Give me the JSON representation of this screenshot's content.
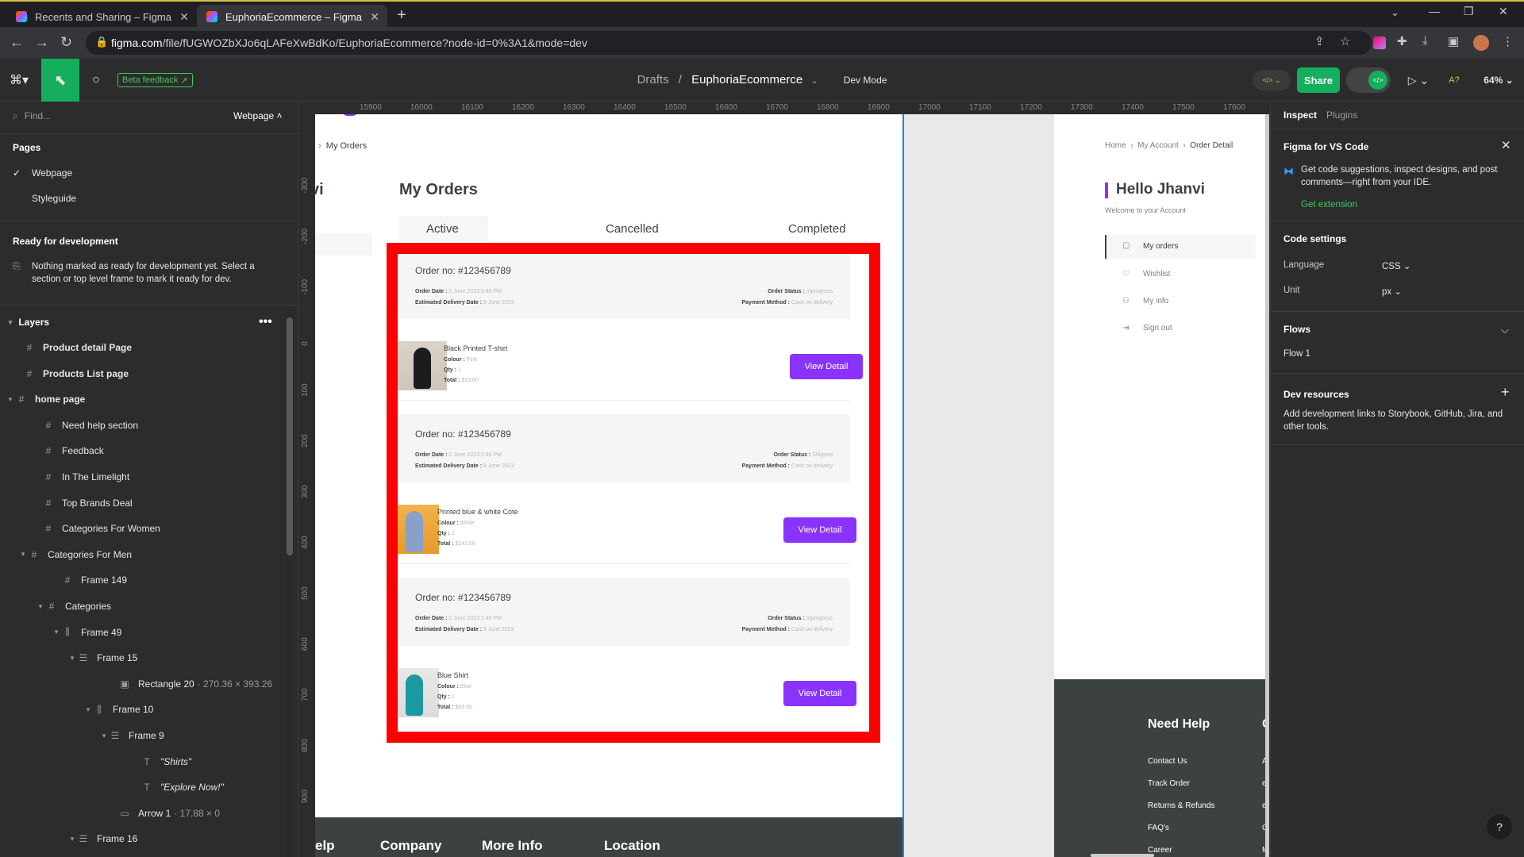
{
  "browser": {
    "tabs": [
      {
        "title": "Recents and Sharing – Figma"
      },
      {
        "title": "EuphoriaEcommerce – Figma"
      }
    ],
    "url_domain": "figma.com",
    "url_path": "/file/fUGWOZbXJo6qLAFeXwBdKo/EuphoriaEcommerce?node-id=0%3A1&mode=dev"
  },
  "toolbar": {
    "beta_feedback": "Beta feedback",
    "crumb_drafts": "Drafts",
    "crumb_sep": "/",
    "file_name": "EuphoriaEcommerce",
    "dev_mode": "Dev Mode",
    "share": "Share",
    "zoom": "64%",
    "dev_toggle": "</>"
  },
  "left_panel": {
    "find_placeholder": "Find...",
    "page_select": "Webpage",
    "pages_title": "Pages",
    "pages": [
      "Webpage",
      "Styleguide"
    ],
    "ready_title": "Ready for development",
    "ready_text": "Nothing marked as ready for development yet. Select a section or top level frame to mark it ready for dev.",
    "layers_title": "Layers",
    "layers": [
      {
        "name": "Product detail Page",
        "dim": ""
      },
      {
        "name": "Products List page",
        "dim": ""
      },
      {
        "name": "home page",
        "dim": ""
      },
      {
        "name": "Need help section",
        "dim": ""
      },
      {
        "name": "Feedback",
        "dim": ""
      },
      {
        "name": "In The Limelight",
        "dim": ""
      },
      {
        "name": "Top Brands Deal",
        "dim": ""
      },
      {
        "name": "Categories For Women",
        "dim": ""
      },
      {
        "name": "Categories For Men",
        "dim": ""
      },
      {
        "name": "Frame 149",
        "dim": ""
      },
      {
        "name": "Categories",
        "dim": ""
      },
      {
        "name": "Frame 49",
        "dim": ""
      },
      {
        "name": "Frame 15",
        "dim": ""
      },
      {
        "name": "Rectangle 20",
        "dim": "· 270.36 × 393.26"
      },
      {
        "name": "Frame 10",
        "dim": ""
      },
      {
        "name": "Frame 9",
        "dim": ""
      },
      {
        "name": "\"Shirts\"",
        "dim": ""
      },
      {
        "name": "\"Explore Now!\"",
        "dim": ""
      },
      {
        "name": "Arrow 1",
        "dim": "· 17.88 × 0"
      },
      {
        "name": "Frame 16",
        "dim": ""
      }
    ]
  },
  "ruler": {
    "top": [
      "15900",
      "16000",
      "16100",
      "16200",
      "16300",
      "16400",
      "16500",
      "16600",
      "16700",
      "16800",
      "16900",
      "17000",
      "17100",
      "17200",
      "17300",
      "17400",
      "17500",
      "17600"
    ],
    "left": [
      "-300",
      "-200",
      "-100",
      "0",
      "100",
      "200",
      "300",
      "400",
      "500",
      "600",
      "700",
      "800",
      "900"
    ]
  },
  "frame_a": {
    "breadcrumb": "My Orders",
    "partial_title": "vi",
    "title": "My Orders",
    "tabs": [
      "Active",
      "Cancelled",
      "Completed"
    ],
    "orders": [
      {
        "order_no": "Order no: #123456789",
        "order_date_label": "Order Date :",
        "order_date": "2 June 2023 2:40 PM",
        "delivery_label": "Estimated Delivery Date :",
        "delivery": "8 June 2023",
        "status_label": "Order Status :",
        "status": "Inprogress",
        "payment_label": "Payment Method :",
        "payment": "Cash on delivery",
        "product": "Black Printed T-shirt",
        "colour_label": "Colour :",
        "colour": "Pink",
        "qty_label": "Qty :",
        "qty": "1",
        "total_label": "Total :",
        "total": "$23.00",
        "button": "View Detail"
      },
      {
        "order_no": "Order no: #123456789",
        "order_date_label": "Order Date :",
        "order_date": "2 June 2023 2:40 PM",
        "delivery_label": "Estimated Delivery Date :",
        "delivery": "8 June 2023",
        "status_label": "Order Status :",
        "status": "Shipped",
        "payment_label": "Payment Method :",
        "payment": "Cash on delivery",
        "product": "Printed blue & white Cote",
        "colour_label": "Colour :",
        "colour": "White",
        "qty_label": "Qty :",
        "qty": "1",
        "total_label": "Total :",
        "total": "$143.00",
        "button": "View Detail"
      },
      {
        "order_no": "Order no: #123456789",
        "order_date_label": "Order Date :",
        "order_date": "2 June 2023 2:40 PM",
        "delivery_label": "Estimated Delivery Date :",
        "delivery": "8 June 2023",
        "status_label": "Order Status :",
        "status": "Inprogress",
        "payment_label": "Payment Method :",
        "payment": "Cash on delivery",
        "product": "Blue Shirt",
        "colour_label": "Colour :",
        "colour": "Blue",
        "qty_label": "Qty :",
        "qty": "1",
        "total_label": "Total :",
        "total": "$93.00",
        "button": "View Detail"
      }
    ],
    "footer": [
      "elp",
      "Company",
      "More Info",
      "Location"
    ]
  },
  "frame_b": {
    "breadcrumb": [
      "Home",
      "My Account",
      "Order Detail"
    ],
    "hello": "Hello Jhanvi",
    "welcome": "Welcome to your Account",
    "menu": [
      "My orders",
      "Wishlist",
      "My info",
      "Sign out"
    ],
    "need_help": "Need Help",
    "need_help_partial": "C",
    "help_links": [
      "Contact Us",
      "Track Order",
      "Returns & Refunds",
      "FAQ's",
      "Career"
    ],
    "help_partials": [
      "Al",
      "eu",
      "eu",
      "Cc",
      "M"
    ]
  },
  "right_panel": {
    "tabs": [
      "Inspect",
      "Plugins"
    ],
    "vs_title": "Figma for VS Code",
    "vs_text": "Get code suggestions, inspect designs, and post comments—right from your IDE.",
    "vs_link": "Get extension",
    "code_settings": "Code settings",
    "language_label": "Language",
    "language": "CSS",
    "unit_label": "Unit",
    "unit": "px",
    "flows_title": "Flows",
    "flow": "Flow 1",
    "dev_resources": "Dev resources",
    "dev_text": "Add development links to Storybook, GitHub, Jira, and other tools.",
    "help": "?"
  },
  "colors": {
    "accent": "#8a33fd",
    "highlight": "#ff0000",
    "share": "#14ae5c",
    "beta": "#3ccb5a",
    "link_green": "#3ccb5a"
  }
}
